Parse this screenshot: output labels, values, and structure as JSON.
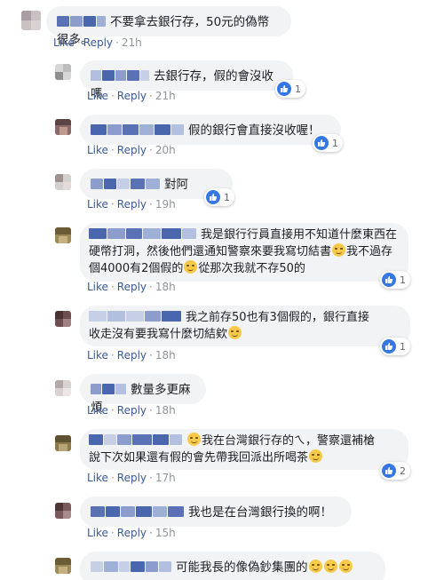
{
  "actions": {
    "like": "Like",
    "reply": "Reply",
    "sep": "·"
  },
  "colors": {
    "bubble": "#f2f3f5",
    "link": "#385898",
    "like_blue": "#3578e5",
    "name_blur": "#4a66ad"
  },
  "comments": [
    {
      "text": "不要拿去銀行存，50元的偽幣很多。",
      "time": "21h",
      "reaction_count": null
    },
    {
      "text": "去銀行存，假的會沒收嗎",
      "time": "21h",
      "reaction_count": "1"
    },
    {
      "text": "假的銀行會直接沒收喔！",
      "time": "20h",
      "reaction_count": "1"
    },
    {
      "text": "對阿",
      "time": "19h",
      "reaction_count": "1"
    },
    {
      "text_line1": "我是銀行行員直接用不知道什麼東西在",
      "text_line2": "硬幣打洞，然後他們還通知警察來要我寫切結書",
      "text_line2b": "我不過存",
      "text_line3": "個4000有2個假的",
      "text_line3b": "從那次我就不存50的",
      "time": "18h",
      "reaction_count": "1"
    },
    {
      "text_line1": "我之前存50也有3個假的，銀行直接",
      "text_line2": "收走沒有要我寫什麼切結欸",
      "time": "18h",
      "reaction_count": "1"
    },
    {
      "text": "數量多更麻煩",
      "time": "18h",
      "reaction_count": null
    },
    {
      "text_line1": "我在台灣銀行存的ㄟ，警察還補槍",
      "text_line2": "說下次如果還有假的會先帶我回派出所喝茶",
      "time": "17h",
      "reaction_count": "2"
    },
    {
      "text": "我也是在台灣銀行換的啊！",
      "time": "15h",
      "reaction_count": null
    },
    {
      "text": "可能我長的像偽鈔集團的",
      "time": "",
      "reaction_count": null
    }
  ]
}
